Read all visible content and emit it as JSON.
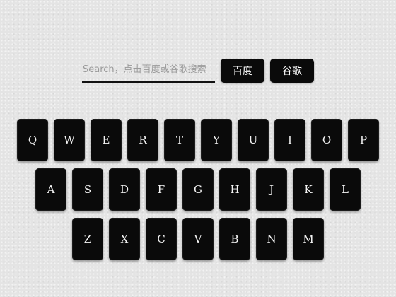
{
  "search": {
    "placeholder": "Search，点击百度或谷歌搜索",
    "value": ""
  },
  "buttons": {
    "baidu": "百度",
    "google": "谷歌"
  },
  "keyboard": {
    "rows": [
      [
        "Q",
        "W",
        "E",
        "R",
        "T",
        "Y",
        "U",
        "I",
        "O",
        "P"
      ],
      [
        "A",
        "S",
        "D",
        "F",
        "G",
        "H",
        "J",
        "K",
        "L"
      ],
      [
        "Z",
        "X",
        "C",
        "V",
        "B",
        "N",
        "M"
      ]
    ]
  },
  "colors": {
    "key_background": "#0a0a0a",
    "key_text": "#f4f4f4",
    "page_background": "#e4e4e4",
    "search_underline": "#111111"
  }
}
